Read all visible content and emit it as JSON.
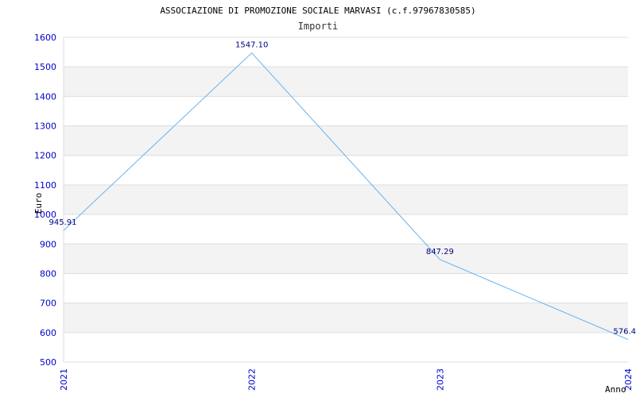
{
  "chart_data": {
    "type": "line",
    "title": "ASSOCIAZIONE DI PROMOZIONE SOCIALE MARVASI (c.f.97967830585)",
    "subtitle": "Importi",
    "xlabel": "Anno",
    "ylabel": "Euro",
    "categories": [
      "2021",
      "2022",
      "2023",
      "2024"
    ],
    "values": [
      945.91,
      1547.1,
      847.29,
      576.4
    ],
    "data_labels": [
      "945.91",
      "1547.10",
      "847.29",
      "576.4"
    ],
    "ylim": [
      500,
      1600
    ],
    "yticks": [
      500,
      600,
      700,
      800,
      900,
      1000,
      1100,
      1200,
      1300,
      1400,
      1500,
      1600
    ],
    "grid": "horizontal alternating bands",
    "colors": {
      "line": "#66b2ee",
      "band": "#f3f3f3",
      "grid": "#dddddd",
      "tick_text": "#0000cc",
      "data_label": "#000080"
    }
  }
}
